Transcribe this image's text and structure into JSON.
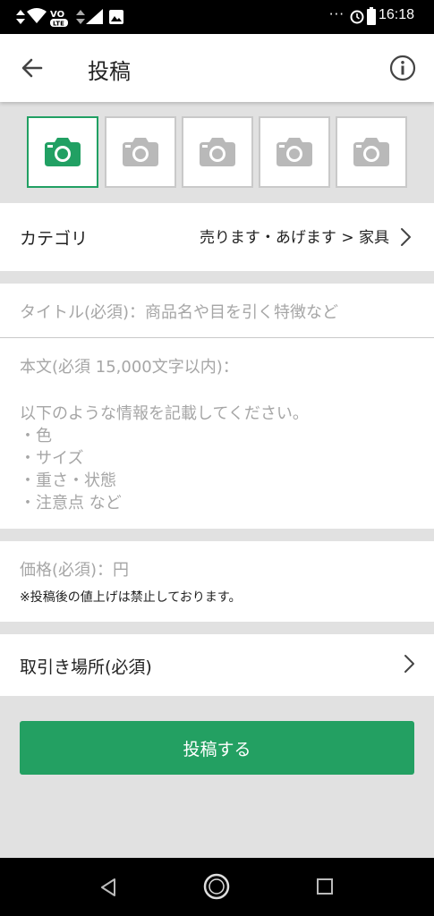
{
  "status_bar": {
    "time": "16:18",
    "dots": "···",
    "network_label": "VoLTE"
  },
  "app_bar": {
    "title": "投稿",
    "back_icon": "arrow-left-icon",
    "info_icon": "info-circle-icon"
  },
  "photo_slots": [
    {
      "state": "active"
    },
    {
      "state": "empty"
    },
    {
      "state": "empty"
    },
    {
      "state": "empty"
    },
    {
      "state": "empty"
    }
  ],
  "category": {
    "label": "カテゴリ",
    "value": "売ります・あげます > 家具"
  },
  "form": {
    "title_placeholder": "タイトル(必須)：商品名や目を引く特徴など",
    "body_placeholder_header": "本文(必須 15,000文字以内)：",
    "body_placeholder_intro": "以下のような情報を記載してください。",
    "body_placeholder_items": [
      "・色",
      "・サイズ",
      "・重さ・状態",
      "・注意点 など"
    ],
    "price_placeholder": "価格(必須)：円",
    "price_note": "※投稿後の値上げは禁止しております。"
  },
  "location": {
    "label": "取引き場所(必須)"
  },
  "submit": {
    "label": "投稿する"
  },
  "colors": {
    "accent": "#23a062",
    "background": "#e1e1e1",
    "placeholder": "#a6a6a6"
  }
}
